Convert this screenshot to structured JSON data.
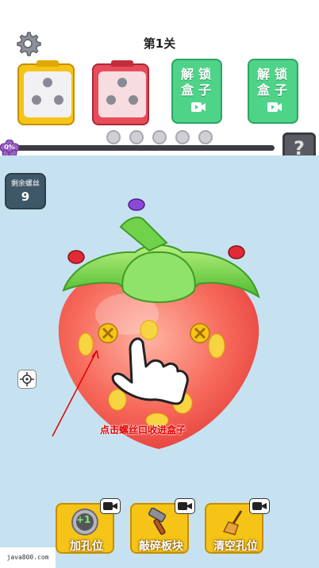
{
  "header": {
    "level_title": "第1关",
    "settings_icon": "gear-icon"
  },
  "boxes": [
    {
      "color": "#f5c417",
      "holes": 3,
      "filled": 0
    },
    {
      "color": "#e84b5a",
      "holes": 3,
      "filled": 0
    }
  ],
  "locked_boxes": [
    {
      "label": "解锁盒子",
      "icon": "video-icon"
    },
    {
      "label": "解锁盒子",
      "icon": "video-icon"
    }
  ],
  "queue_slots": 5,
  "progress": {
    "percent_label": "0%",
    "value": 0
  },
  "mystery_box": "?",
  "remaining": {
    "label": "剩余螺丝",
    "value": "9"
  },
  "hint_text": "点击螺丝口收进盒子",
  "tools": [
    {
      "label": "加孔位",
      "badge": "+1",
      "icon": "add-hole-icon"
    },
    {
      "label": "敲碎板块",
      "icon": "hammer-icon"
    },
    {
      "label": "清空孔位",
      "icon": "broom-icon"
    }
  ],
  "watermark": "java800.com",
  "colors": {
    "play_bg": "#c6e2f0",
    "yellow": "#f5c417",
    "red": "#e84b5a",
    "green": "#4fd389"
  }
}
